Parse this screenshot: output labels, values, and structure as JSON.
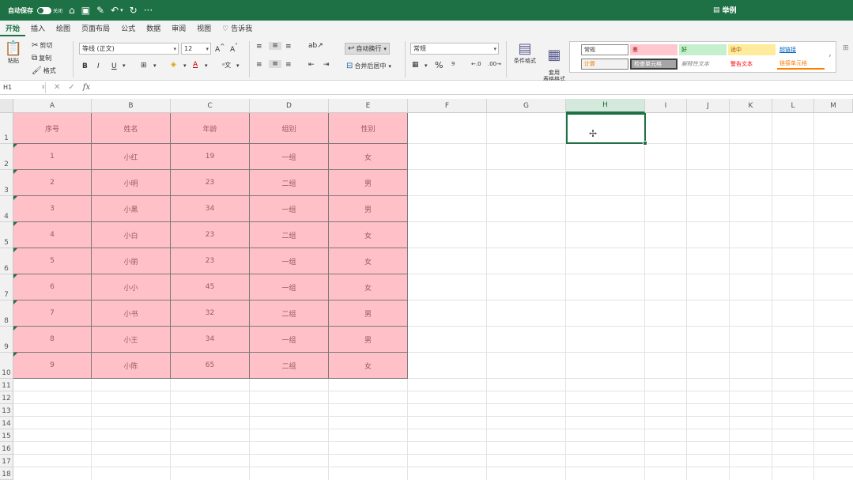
{
  "titlebar": {
    "autosave_label": "自动保存",
    "autosave_state": "关闭",
    "doc_title": "举例"
  },
  "menu": {
    "tabs": [
      "开始",
      "插入",
      "绘图",
      "页面布局",
      "公式",
      "数据",
      "审阅",
      "视图",
      "告诉我"
    ],
    "active": "开始"
  },
  "ribbon": {
    "paste": "粘贴",
    "cut": "剪切",
    "copy": "复制",
    "format_painter": "格式",
    "font_name": "等线 (正文)",
    "font_size": "12",
    "wrap_text": "自动换行",
    "merge_center": "合并后居中",
    "number_format": "常规",
    "conditional_format": "条件格式",
    "format_as_table": "套用\n表格格式",
    "styles": [
      {
        "label": "常规",
        "bg": "#ffffff",
        "fg": "#333333"
      },
      {
        "label": "差",
        "bg": "#ffc7ce",
        "fg": "#9c0006"
      },
      {
        "label": "好",
        "bg": "#c6efce",
        "fg": "#006100"
      },
      {
        "label": "适中",
        "bg": "#ffeb9c",
        "fg": "#9c5700"
      },
      {
        "label": "超链接",
        "bg": "#ffffff",
        "fg": "#0563c1"
      },
      {
        "label": "计算",
        "bg": "#f2f2f2",
        "fg": "#fa7d00"
      },
      {
        "label": "检查单元格",
        "bg": "#a5a5a5",
        "fg": "#ffffff"
      },
      {
        "label": "解释性文本",
        "bg": "#ffffff",
        "fg": "#7f7f7f"
      },
      {
        "label": "警告文本",
        "bg": "#ffffff",
        "fg": "#ff0000"
      },
      {
        "label": "链接单元格",
        "bg": "#ffffff",
        "fg": "#fa7d00"
      }
    ]
  },
  "formula_bar": {
    "name_box": "H1",
    "fx": "fx",
    "content": ""
  },
  "sheet": {
    "columns": [
      "A",
      "B",
      "C",
      "D",
      "E",
      "F",
      "G",
      "H",
      "I",
      "J",
      "K",
      "L",
      "M"
    ],
    "selected_column": "H",
    "rows": [
      "1",
      "2",
      "3",
      "4",
      "5",
      "6",
      "7",
      "8",
      "9",
      "10",
      "11",
      "12",
      "13",
      "14",
      "15",
      "16",
      "17",
      "18"
    ],
    "headers": [
      "序号",
      "姓名",
      "年龄",
      "组别",
      "性别"
    ],
    "data": [
      [
        "1",
        "小红",
        "19",
        "一组",
        "女"
      ],
      [
        "2",
        "小明",
        "23",
        "二组",
        "男"
      ],
      [
        "3",
        "小黑",
        "34",
        "一组",
        "男"
      ],
      [
        "4",
        "小白",
        "23",
        "二组",
        "女"
      ],
      [
        "5",
        "小丽",
        "23",
        "一组",
        "女"
      ],
      [
        "6",
        "小小",
        "45",
        "一组",
        "女"
      ],
      [
        "7",
        "小书",
        "32",
        "二组",
        "男"
      ],
      [
        "8",
        "小王",
        "34",
        "一组",
        "男"
      ],
      [
        "9",
        "小陈",
        "65",
        "二组",
        "女"
      ]
    ],
    "fill_color": "#ffc0c7",
    "accent_color": "#1e7145"
  }
}
